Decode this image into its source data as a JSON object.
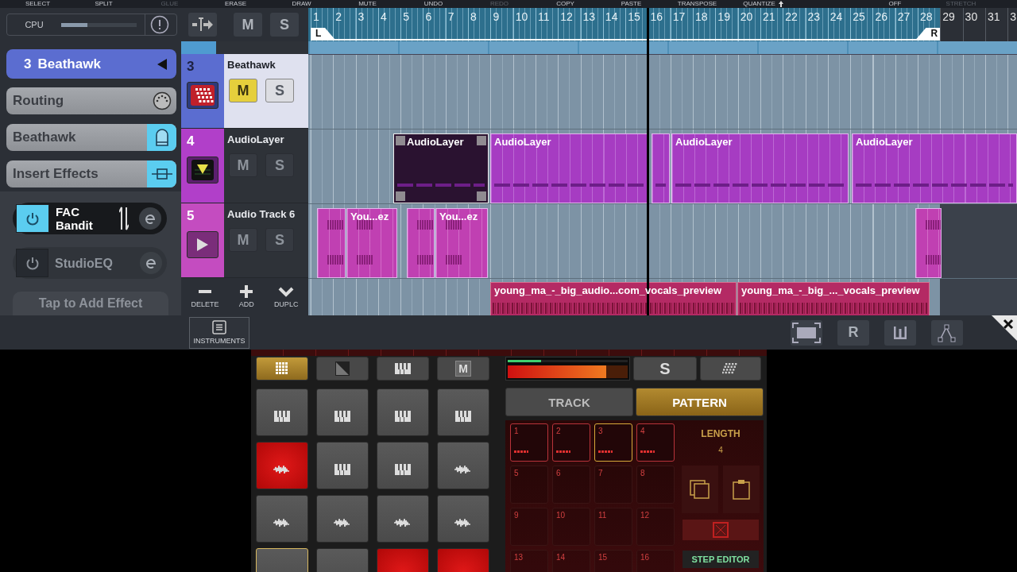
{
  "toolbar": {
    "tools": [
      {
        "label": "SELECT",
        "disabled": false
      },
      {
        "label": "SPLIT",
        "disabled": false
      },
      {
        "label": "GLUE",
        "disabled": true
      },
      {
        "label": "ERASE",
        "disabled": false
      },
      {
        "label": "DRAW",
        "disabled": false
      },
      {
        "label": "MUTE",
        "disabled": false
      },
      {
        "label": "UNDO",
        "disabled": false
      },
      {
        "label": "REDO",
        "disabled": true
      },
      {
        "label": "COPY",
        "disabled": false
      },
      {
        "label": "PASTE",
        "disabled": false
      },
      {
        "label": "TRANSPOSE",
        "disabled": false
      },
      {
        "label": "QUANTIZE",
        "disabled": false
      },
      {
        "label": "OFF",
        "disabled": false
      },
      {
        "label": "STRETCH",
        "disabled": true
      }
    ]
  },
  "cpu": {
    "label": "CPU",
    "level": 0.35
  },
  "header_toolbar": {
    "mute_label": "M",
    "solo_label": "S"
  },
  "ruler": {
    "bars": [
      "1",
      "2",
      "3",
      "4",
      "5",
      "6",
      "7",
      "8",
      "9",
      "10",
      "11",
      "12",
      "13",
      "14",
      "15",
      "16",
      "17",
      "18",
      "19",
      "20",
      "21",
      "22",
      "23",
      "24",
      "25",
      "26",
      "27",
      "28",
      "29",
      "30",
      "31",
      "3"
    ],
    "left_locator": "L",
    "right_locator": "R"
  },
  "sidebar": {
    "track_button": {
      "number": "3",
      "name": "Beathawk"
    },
    "routing": "Routing",
    "instrument": "Beathawk",
    "insert_effects": "Insert Effects",
    "effects": [
      {
        "name": "FAC Bandit",
        "on": true
      },
      {
        "name": "StudioEQ",
        "on": false
      }
    ],
    "add_effect": "Tap to Add Effect"
  },
  "tracks": [
    {
      "number": "3",
      "name": "Beathawk",
      "kind": "instrument",
      "selected": true,
      "color": "#5b6dd0",
      "mute": {
        "label": "M",
        "on": true
      },
      "solo": {
        "label": "S",
        "on": false
      }
    },
    {
      "number": "4",
      "name": "AudioLayer",
      "kind": "audiolayer",
      "selected": false,
      "color": "#b13fc9",
      "mute": {
        "label": "M",
        "on": false
      },
      "solo": {
        "label": "S",
        "on": false
      },
      "clips": [
        {
          "name": "AudioLayer",
          "selected": true
        },
        {
          "name": "AudioLayer",
          "selected": false
        },
        {
          "selected": false
        },
        {
          "name": "AudioLayer",
          "selected": false
        },
        {
          "name": "AudioLayer",
          "selected": false
        }
      ]
    },
    {
      "number": "5",
      "name": "Audio Track 6",
      "kind": "audio",
      "selected": false,
      "color": "#c44cc0",
      "mute": {
        "label": "M",
        "on": false
      },
      "solo": {
        "label": "S",
        "on": false
      },
      "clips": [
        {
          "selected": false
        },
        {
          "name": "You...ez",
          "selected": false
        },
        {
          "selected": false
        },
        {
          "name": "You...ez",
          "selected": false
        },
        {
          "selected": false
        }
      ]
    }
  ],
  "next_track_clips": [
    {
      "name": "young_ma_-_big_audio...com_vocals_preview"
    },
    {
      "name": "young_ma_-_big_..._vocals_preview"
    }
  ],
  "track_actions": [
    {
      "kind": "delete",
      "label": "DELETE"
    },
    {
      "kind": "add",
      "label": "ADD"
    },
    {
      "kind": "duplicate",
      "label": "DUPLC"
    }
  ],
  "bottom_bar": {
    "instruments_tab": "INSTRUMENTS",
    "read_label": "R"
  },
  "instrument": {
    "mode_tabs": [
      {
        "kind": "grid",
        "selected": true
      },
      {
        "kind": "split",
        "selected": false
      },
      {
        "kind": "keys",
        "selected": false
      },
      {
        "kind": "letter",
        "label": "M",
        "selected": false
      }
    ],
    "pads": [
      {
        "kind": "keys",
        "lit": false,
        "selected": false
      },
      {
        "kind": "keys",
        "lit": false,
        "selected": false
      },
      {
        "kind": "keys",
        "lit": false,
        "selected": false
      },
      {
        "kind": "keys",
        "lit": false,
        "selected": false
      },
      {
        "kind": "wave",
        "lit": true,
        "selected": false
      },
      {
        "kind": "keys",
        "lit": false,
        "selected": false
      },
      {
        "kind": "keys",
        "lit": false,
        "selected": false
      },
      {
        "kind": "wave",
        "lit": false,
        "selected": false
      },
      {
        "kind": "wave",
        "lit": false,
        "selected": false
      },
      {
        "kind": "wave",
        "lit": false,
        "selected": false
      },
      {
        "kind": "wave",
        "lit": false,
        "selected": false
      },
      {
        "kind": "wave",
        "lit": false,
        "selected": false
      },
      {
        "lit": false,
        "selected": true
      },
      {
        "lit": false,
        "selected": false
      },
      {
        "lit": true,
        "selected": false
      },
      {
        "lit": true,
        "selected": false
      }
    ],
    "meters": [
      {
        "kind": "peak",
        "level": 0.28
      },
      {
        "kind": "volume",
        "level": 0.82
      }
    ],
    "solo_label": "S",
    "view_tabs": [
      {
        "label": "TRACK",
        "selected": false
      },
      {
        "label": "PATTERN",
        "selected": true
      }
    ],
    "patterns": [
      {
        "number": "1",
        "filled": true,
        "selected": false
      },
      {
        "number": "2",
        "filled": true,
        "selected": false
      },
      {
        "number": "3",
        "filled": true,
        "selected": true
      },
      {
        "number": "4",
        "filled": true,
        "selected": false
      },
      {
        "number": "5",
        "filled": false,
        "selected": false
      },
      {
        "number": "6",
        "filled": false,
        "selected": false
      },
      {
        "number": "7",
        "filled": false,
        "selected": false
      },
      {
        "number": "8",
        "filled": false,
        "selected": false
      },
      {
        "number": "9",
        "filled": false,
        "selected": false
      },
      {
        "number": "10",
        "filled": false,
        "selected": false
      },
      {
        "number": "11",
        "filled": false,
        "selected": false
      },
      {
        "number": "12",
        "filled": false,
        "selected": false
      },
      {
        "number": "13",
        "filled": false,
        "selected": false
      },
      {
        "number": "14",
        "filled": false,
        "selected": false
      },
      {
        "number": "15",
        "filled": false,
        "selected": false
      },
      {
        "number": "16",
        "filled": false,
        "selected": false
      }
    ],
    "length": {
      "label": "LENGTH",
      "value": "4"
    },
    "step_editor": "STEP EDITOR"
  }
}
